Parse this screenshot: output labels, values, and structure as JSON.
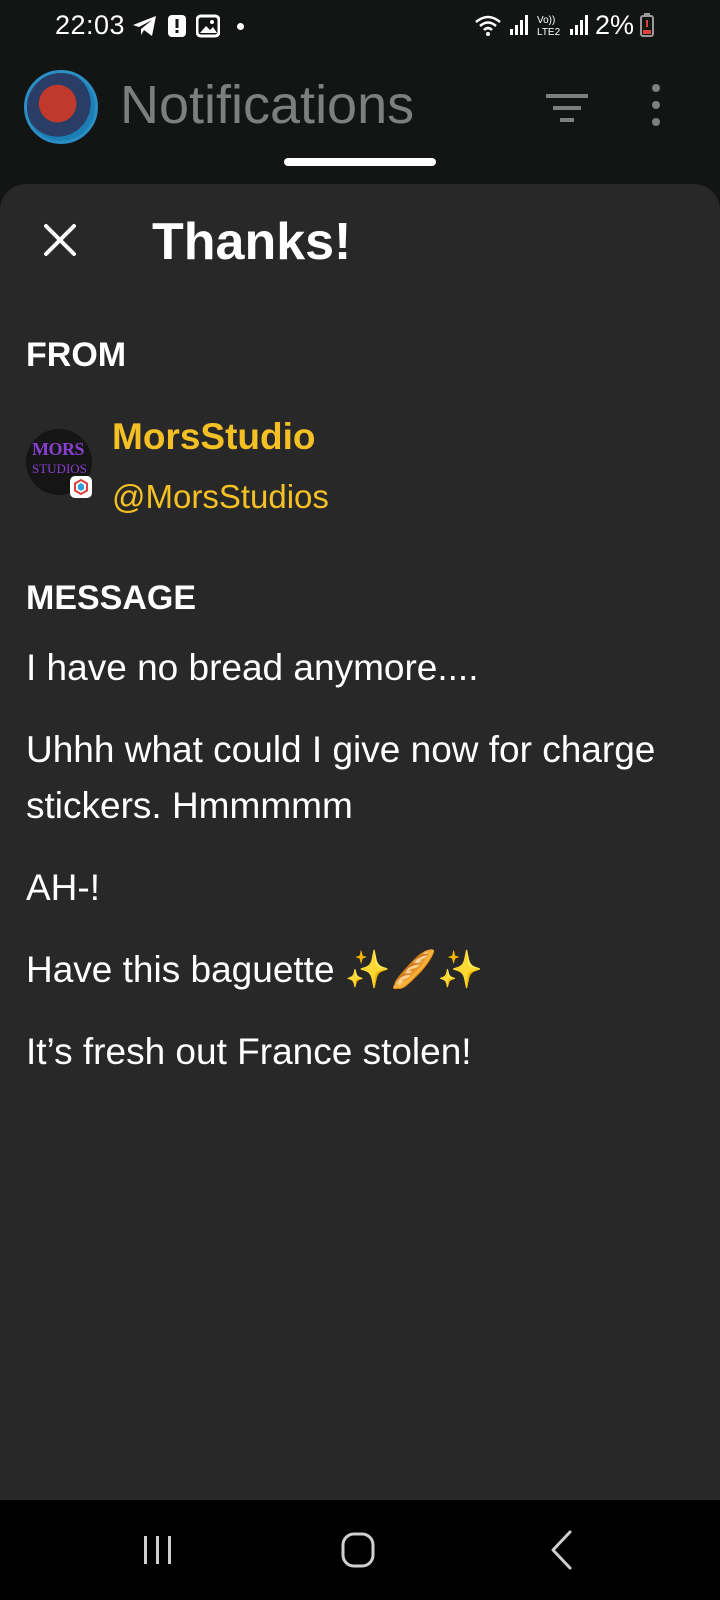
{
  "status_bar": {
    "time": "22:03",
    "battery": "2%",
    "icons": [
      "telegram-icon",
      "alert-icon",
      "gallery-icon",
      "notification-dot",
      "wifi-icon",
      "signal-icon",
      "volte-icon",
      "signal-icon",
      "battery-low-icon"
    ],
    "network_label": "LTE2"
  },
  "app_bar": {
    "title": "Notifications"
  },
  "sheet": {
    "title": "Thanks!",
    "from_label": "FROM",
    "sender": {
      "name": "MorsStudio",
      "handle": "@MorsStudios",
      "avatar_text_1": "MORS",
      "avatar_text_2": "STUDIOS"
    },
    "message_label": "MESSAGE",
    "message_lines": [
      "I have no bread anymore....",
      "Uhhh what could I give now for charge stickers. Hmmmmm",
      "AH-!",
      "Have this baguette ✨🥖✨",
      "It’s fresh out France stolen!"
    ]
  },
  "colors": {
    "background": "#121514",
    "sheet": "#282828",
    "accent_yellow": "#f5c024",
    "text": "#ffffff",
    "muted_title": "#7b807d"
  }
}
